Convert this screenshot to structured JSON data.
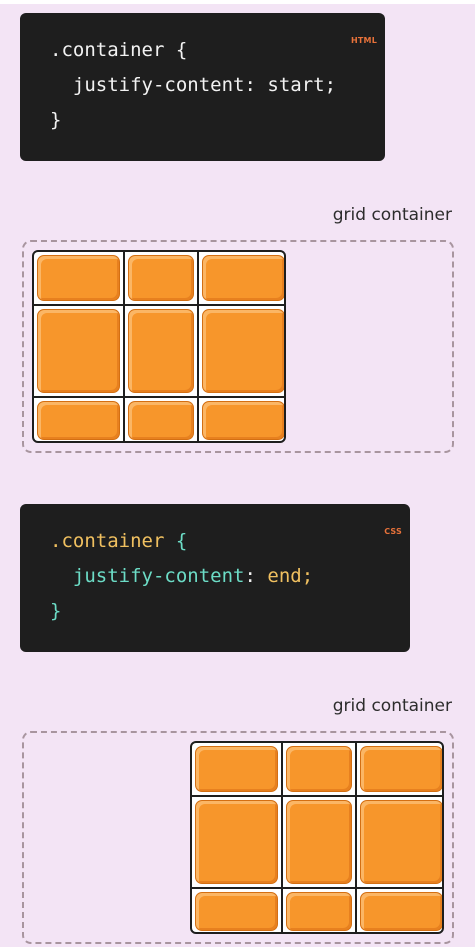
{
  "blocks": [
    {
      "tag": "HTML",
      "selector": ".container",
      "open_brace": "{",
      "property": "justify-content",
      "colon": ":",
      "value": "start;",
      "close_brace": "}",
      "label": "grid container"
    },
    {
      "tag": "CSS",
      "selector": ".container",
      "open_brace": "{",
      "property": "justify-content",
      "colon": ":",
      "value": "end;",
      "close_brace": "}",
      "label": "grid container"
    }
  ],
  "grid": {
    "rows": 3,
    "cols": 3,
    "item_color": "#f7962b"
  },
  "colors": {
    "background": "#f3e4f5",
    "code_bg": "#1e1e1e",
    "tag": "#e8723a",
    "selector_plain": "#f2f2f2",
    "selector_accent": "#f0c060",
    "keyword": "#6cdcc6"
  }
}
